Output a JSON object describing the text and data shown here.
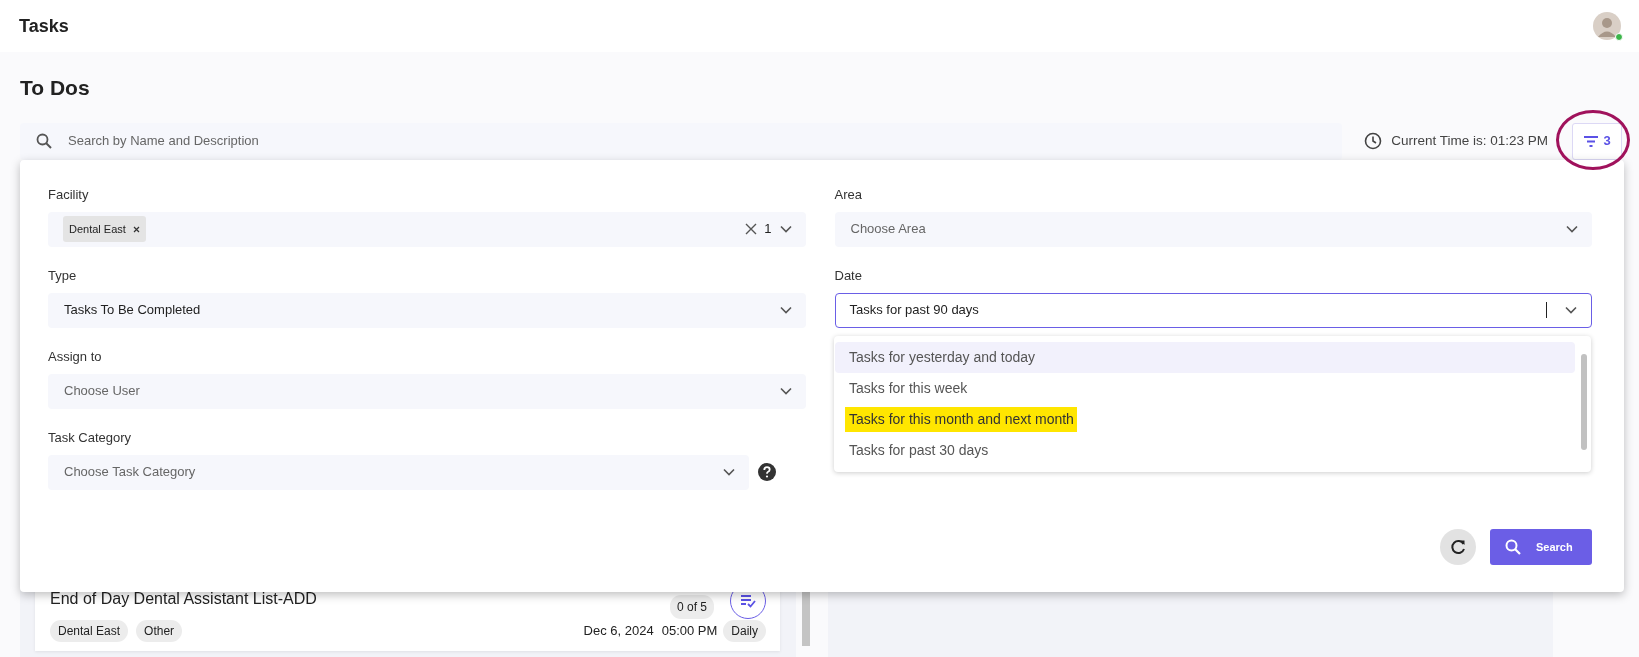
{
  "app": {
    "title": "Tasks",
    "avatar": {
      "online": true
    }
  },
  "page": {
    "title": "To Dos"
  },
  "search": {
    "placeholder": "Search by Name and Description"
  },
  "current_time": "Current Time is: 01:23 PM",
  "filter_button": {
    "count": "3",
    "annotated": true
  },
  "filters": {
    "left_fields": [
      {
        "label": "Facility",
        "kind": "multi",
        "chips": [
          "Dental East"
        ],
        "count": "1"
      },
      {
        "label": "Type",
        "kind": "select",
        "value": "Tasks To Be Completed"
      },
      {
        "label": "Assign to",
        "kind": "select",
        "placeholder": "Choose User"
      },
      {
        "label": "Task Category",
        "kind": "select",
        "placeholder": "Choose Task Category",
        "help": true
      }
    ],
    "right_fields": [
      {
        "label": "Area",
        "kind": "select",
        "placeholder": "Choose Area"
      },
      {
        "label": "Date",
        "kind": "select",
        "value": "Tasks for past 90 days",
        "focused": true,
        "options": [
          {
            "label": "Tasks for yesterday and today",
            "active": true,
            "highlighted": false
          },
          {
            "label": "Tasks for this week",
            "active": false,
            "highlighted": false
          },
          {
            "label": "Tasks for this month and next month",
            "active": false,
            "highlighted": true
          },
          {
            "label": "Tasks for past 30 days",
            "active": false,
            "highlighted": false
          }
        ]
      }
    ],
    "search_button": "Search"
  },
  "task_card": {
    "title": "End of Day Dental Assistant List-ADD",
    "progress": "0 of 5",
    "tags": [
      "Dental East",
      "Other"
    ],
    "due_date": "Dec 6, 2024",
    "due_time": "05:00 PM",
    "frequency": "Daily"
  }
}
